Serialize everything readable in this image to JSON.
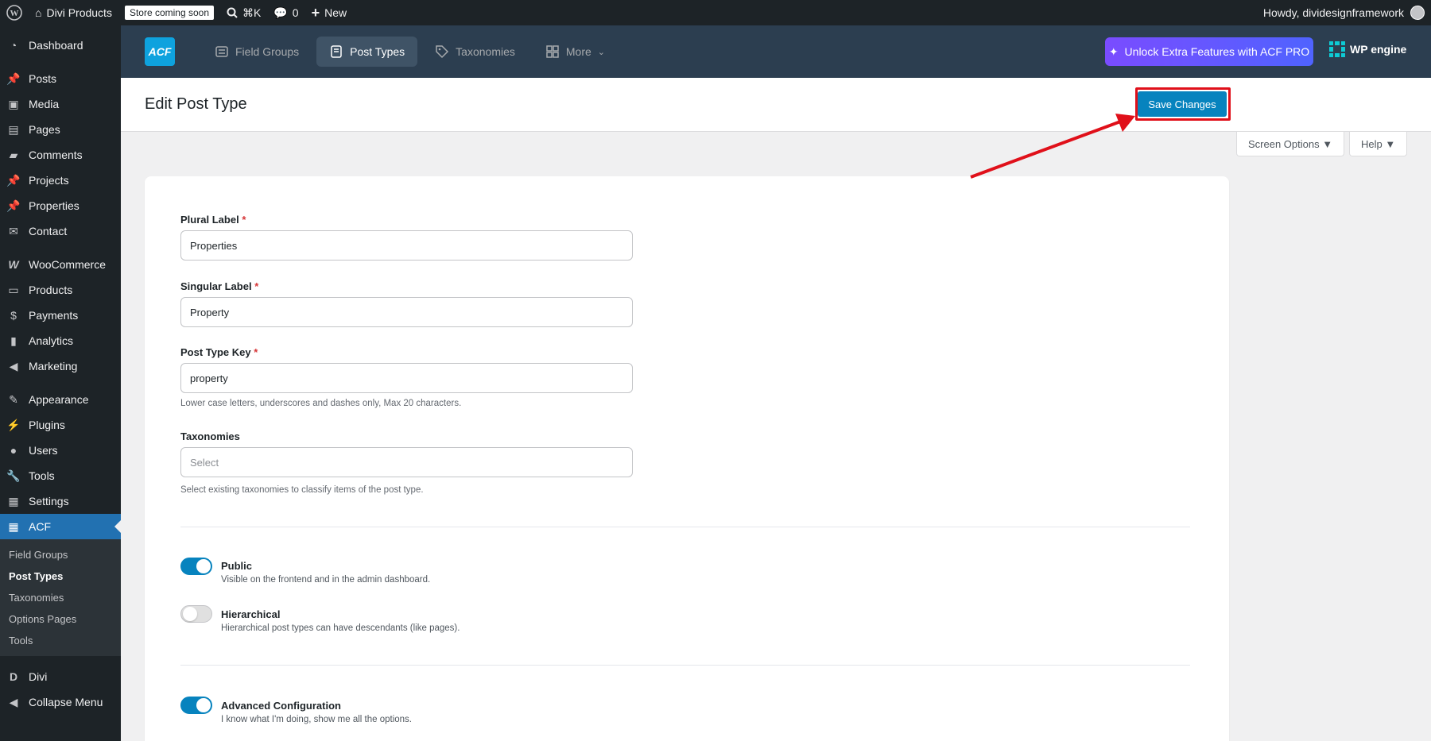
{
  "adminbar": {
    "site_name": "Divi Products",
    "badge": "Store coming soon",
    "shortcut": "⌘K",
    "comments_count": "0",
    "new_label": "New",
    "greeting": "Howdy, dividesignframework"
  },
  "sidebar": {
    "items": [
      {
        "label": "Dashboard",
        "icon": "dashboard-icon"
      },
      {
        "label": "Posts",
        "icon": "pin-icon"
      },
      {
        "label": "Media",
        "icon": "media-icon"
      },
      {
        "label": "Pages",
        "icon": "pages-icon"
      },
      {
        "label": "Comments",
        "icon": "comment-icon"
      },
      {
        "label": "Projects",
        "icon": "pin-icon"
      },
      {
        "label": "Properties",
        "icon": "pin-icon"
      },
      {
        "label": "Contact",
        "icon": "envelope-icon"
      },
      {
        "label": "WooCommerce",
        "icon": "woo-icon"
      },
      {
        "label": "Products",
        "icon": "archive-icon"
      },
      {
        "label": "Payments",
        "icon": "dollar-icon"
      },
      {
        "label": "Analytics",
        "icon": "bar-chart-icon"
      },
      {
        "label": "Marketing",
        "icon": "megaphone-icon"
      },
      {
        "label": "Appearance",
        "icon": "brush-icon"
      },
      {
        "label": "Plugins",
        "icon": "plug-icon"
      },
      {
        "label": "Users",
        "icon": "user-icon"
      },
      {
        "label": "Tools",
        "icon": "wrench-icon"
      },
      {
        "label": "Settings",
        "icon": "sliders-icon"
      },
      {
        "label": "ACF",
        "icon": "table-icon"
      }
    ],
    "submenu": [
      "Field Groups",
      "Post Types",
      "Taxonomies",
      "Options Pages",
      "Tools"
    ],
    "bottom": [
      {
        "label": "Divi",
        "icon": "divi-icon"
      },
      {
        "label": "Collapse Menu",
        "icon": "collapse-icon"
      }
    ]
  },
  "acf_header": {
    "logo": "ACF",
    "tabs": [
      "Field Groups",
      "Post Types",
      "Taxonomies",
      "More"
    ],
    "pro_button": "Unlock Extra Features with ACF PRO",
    "wpengine": "WP engine"
  },
  "titlebar": {
    "title": "Edit Post Type",
    "save_label": "Save Changes",
    "screen_options": "Screen Options ▼",
    "help": "Help ▼"
  },
  "form": {
    "plural_label": "Plural Label",
    "plural_value": "Properties",
    "singular_label": "Singular Label",
    "singular_value": "Property",
    "key_label": "Post Type Key",
    "key_value": "property",
    "key_help": "Lower case letters, underscores and dashes only, Max 20 characters.",
    "taxonomies_label": "Taxonomies",
    "taxonomies_placeholder": "Select",
    "taxonomies_help": "Select existing taxonomies to classify items of the post type.",
    "required_mark": "*"
  },
  "toggles": {
    "public_title": "Public",
    "public_desc": "Visible on the frontend and in the admin dashboard.",
    "public_on": true,
    "hier_title": "Hierarchical",
    "hier_desc": "Hierarchical post types can have descendants (like pages).",
    "hier_on": false,
    "adv_title": "Advanced Configuration",
    "adv_desc": "I know what I'm doing, show me all the options.",
    "adv_on": true
  },
  "colors": {
    "admin_dark": "#1d2327",
    "accent_blue": "#0783be",
    "annotation_red": "#e0101a"
  }
}
